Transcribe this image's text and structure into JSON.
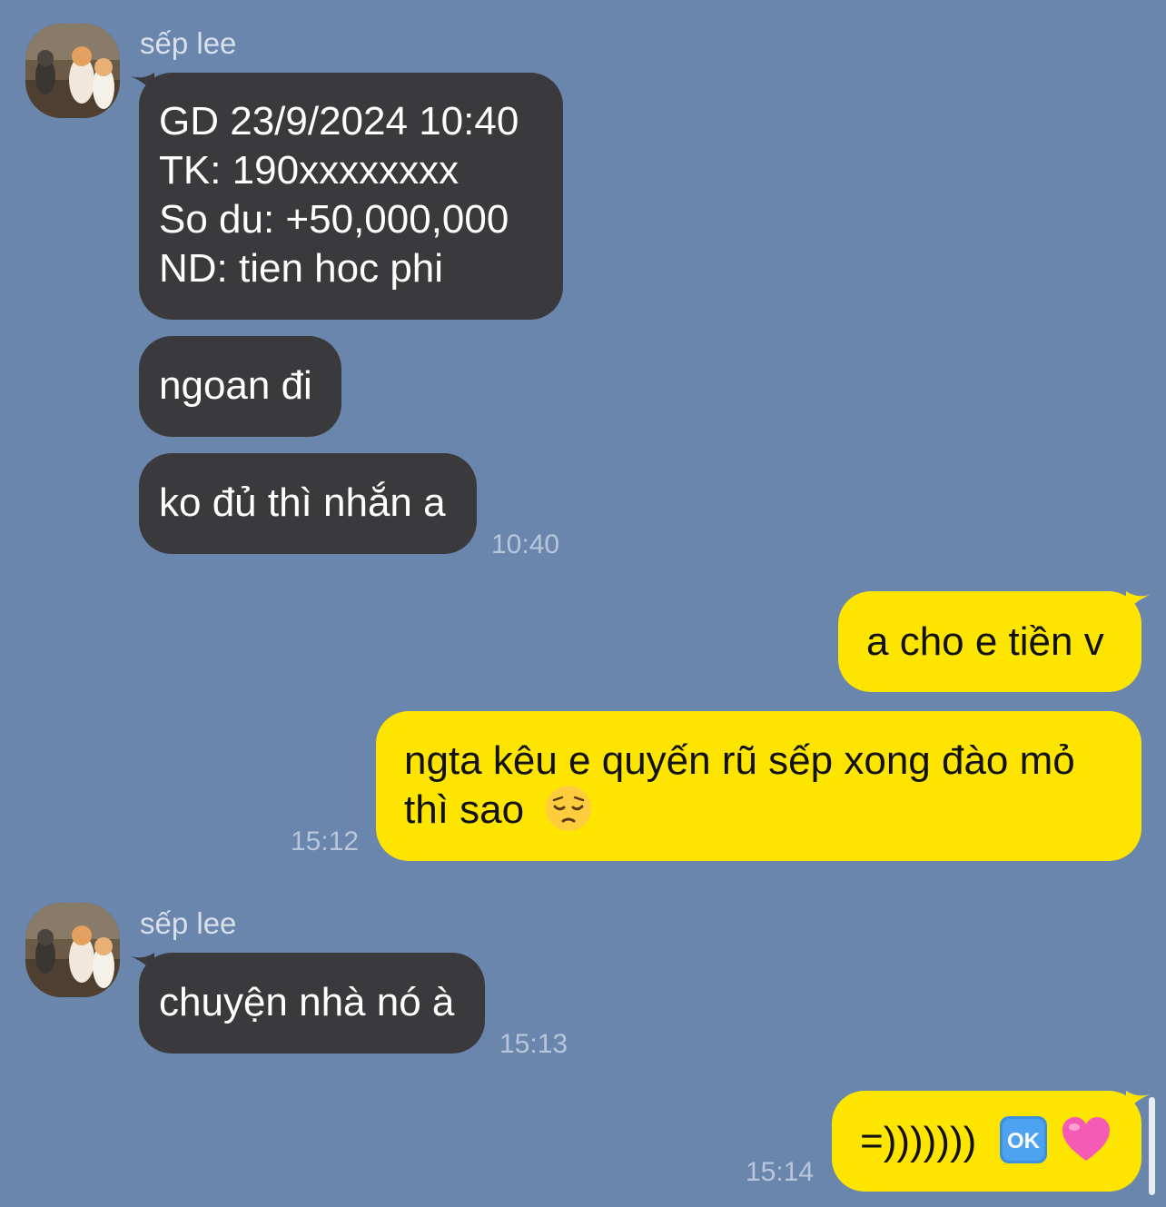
{
  "sender": {
    "name": "sếp lee"
  },
  "messages": {
    "m1": {
      "lines": [
        "GD 23/9/2024 10:40",
        "TK: 190xxxxxxxx",
        "So du: +50,000,000",
        "ND: tien hoc phi"
      ]
    },
    "m2": {
      "text": "ngoan đi"
    },
    "m3": {
      "text": "ko đủ thì nhắn a",
      "time": "10:40"
    },
    "m4": {
      "text": "a cho e tiền v"
    },
    "m5": {
      "line1": "ngta kêu e quyến rũ sếp xong đào mỏ",
      "line2": "thì sao",
      "emoji": "pensive-face-emoji",
      "time": "15:12"
    },
    "m6": {
      "text": "chuyện nhà nó à",
      "time": "15:13"
    },
    "m7": {
      "text": "=)))))))",
      "emojis": [
        "ok-button-emoji",
        "pink-heart-emoji"
      ],
      "time": "15:14"
    }
  },
  "colors": {
    "background": "#6a86ad",
    "incoming_bubble": "#3a3a3c",
    "outgoing_bubble": "#fee500",
    "timestamp": "#b8c6db"
  }
}
